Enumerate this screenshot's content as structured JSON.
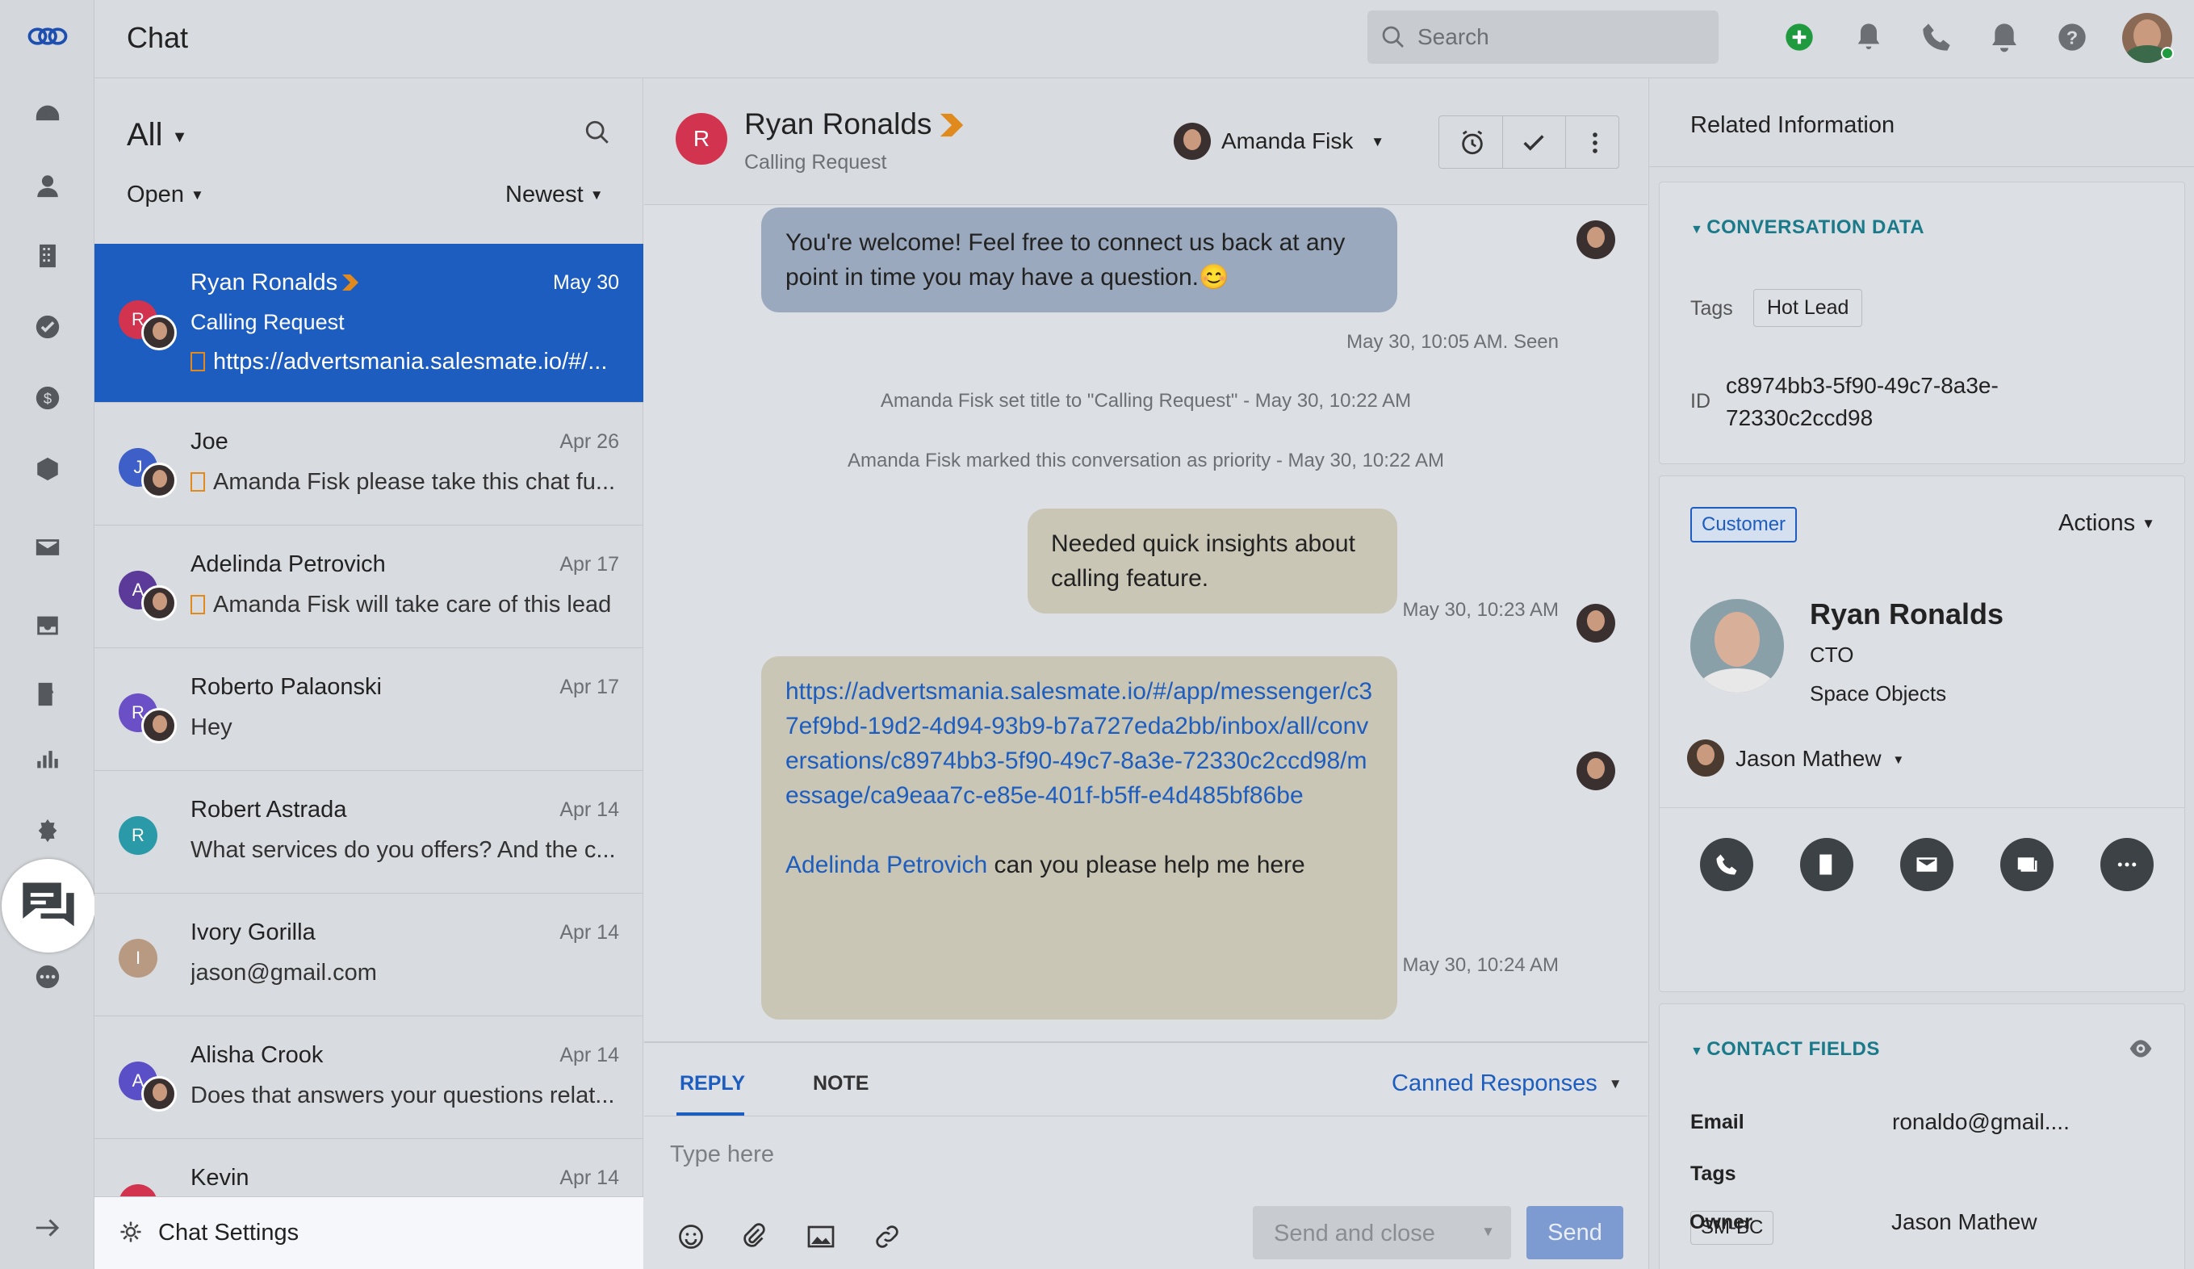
{
  "app": {
    "title": "Chat"
  },
  "search": {
    "placeholder": "Search"
  },
  "list": {
    "filter": "All",
    "status": "Open",
    "sort": "Newest",
    "conversations": [
      {
        "name": "Ryan Ronalds",
        "initial": "R",
        "date": "May 30",
        "subtitle": "Calling Request",
        "preview": "https://advertsmania.salesmate.io/#/...",
        "color": "#d2334f"
      },
      {
        "name": "Joe",
        "initial": "J",
        "date": "Apr 26",
        "subtitle": "",
        "preview": "Amanda Fisk please take this chat fu...",
        "color": "#3d5fc7"
      },
      {
        "name": "Adelinda Petrovich",
        "initial": "A",
        "date": "Apr 17",
        "subtitle": "",
        "preview": "Amanda Fisk will take care of this lead",
        "color": "#5b3a9a"
      },
      {
        "name": "Roberto Palaonski",
        "initial": "R",
        "date": "Apr 17",
        "subtitle": "",
        "preview": "Hey",
        "color": "#6a4fc7"
      },
      {
        "name": "Robert Astrada",
        "initial": "R",
        "date": "Apr 14",
        "subtitle": "",
        "preview": "What services do you offers? And the c...",
        "color": "#2a9aa8"
      },
      {
        "name": "Ivory Gorilla",
        "initial": "I",
        "date": "Apr 14",
        "subtitle": "",
        "preview": "jason@gmail.com",
        "color": "#b89a82"
      },
      {
        "name": "Alisha Crook",
        "initial": "A",
        "date": "Apr 14",
        "subtitle": "",
        "preview": "Does that answers your questions relat...",
        "color": "#5a4fc7"
      },
      {
        "name": "Kevin",
        "initial": "K",
        "date": "Apr 14",
        "subtitle": "",
        "preview": "",
        "color": "#d2334f"
      }
    ],
    "settings_label": "Chat Settings"
  },
  "chat": {
    "contact_name": "Ryan Ronalds",
    "contact_initial": "R",
    "subtitle": "Calling Request",
    "assignee": "Amanda Fisk",
    "messages": {
      "m1": "You're welcome! Feel free to connect us back at any point in time you may have a question.😊",
      "m1_meta": "May 30, 10:05 AM. Seen",
      "sys1": "Amanda Fisk set title to \"Calling Request\" - May 30, 10:22 AM",
      "sys2": "Amanda Fisk marked this conversation as priority - May 30, 10:22 AM",
      "m2": "Needed quick insights about calling feature.",
      "m2_meta": "May 30, 10:23 AM",
      "m3_link": "https://advertsmania.salesmate.io/#/app/messenger/c37ef9bd-19d2-4d94-93b9-b7a727eda2bb/inbox/all/conversations/c8974bb3-5f90-49c7-8a3e-72330c2ccd98/message/ca9eaa7c-e85e-401f-b5ff-e4d485bf86be",
      "m3_mention": "Adelinda Petrovich",
      "m3_text": " can you please help me here",
      "m3_meta": "May 30, 10:24 AM"
    }
  },
  "reply": {
    "tab_reply": "REPLY",
    "tab_note": "NOTE",
    "canned": "Canned Responses",
    "placeholder": "Type here",
    "send_close": "Send and close",
    "send": "Send"
  },
  "right": {
    "title": "Related Information",
    "conv_data": "CONVERSATION DATA",
    "tags_label": "Tags",
    "tag": "Hot Lead",
    "id_label": "ID",
    "id_value": "c8974bb3-5f90-49c7-8a3e-72330c2ccd98",
    "badge": "Customer",
    "actions": "Actions",
    "contact_name": "Ryan Ronalds",
    "contact_title": "CTO",
    "company": "Space Objects",
    "owner_select": "Jason Mathew",
    "contact_fields": "CONTACT FIELDS",
    "email_label": "Email",
    "email_value": "ronaldo@gmail....",
    "tags2_label": "Tags",
    "tag2": "SM-BC",
    "owner_label": "Owner",
    "owner_value": "Jason Mathew"
  },
  "colors": {
    "accent": "#1d5dbf",
    "teal": "#1a7a8a",
    "bubble_blue": "#9aa9bd",
    "bubble_tan": "#c9c6b6"
  }
}
